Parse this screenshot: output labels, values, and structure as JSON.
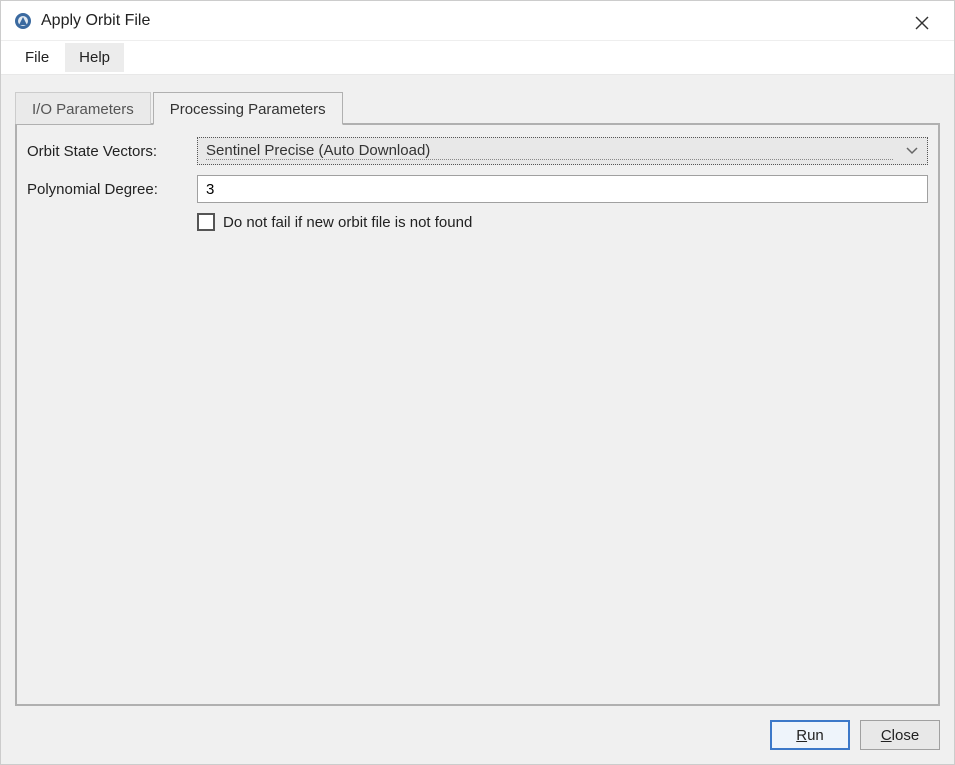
{
  "window": {
    "title": "Apply Orbit File"
  },
  "menu": {
    "file": "File",
    "help": "Help"
  },
  "tabs": {
    "io": "I/O Parameters",
    "processing": "Processing Parameters"
  },
  "form": {
    "orbit_label": "Orbit State Vectors:",
    "orbit_value": "Sentinel Precise (Auto Download)",
    "poly_label": "Polynomial Degree:",
    "poly_value": "3",
    "checkbox_label": "Do not fail if new orbit file is not found"
  },
  "buttons": {
    "run_prefix": "R",
    "run_suffix": "un",
    "close_prefix": "C",
    "close_suffix": "lose"
  }
}
